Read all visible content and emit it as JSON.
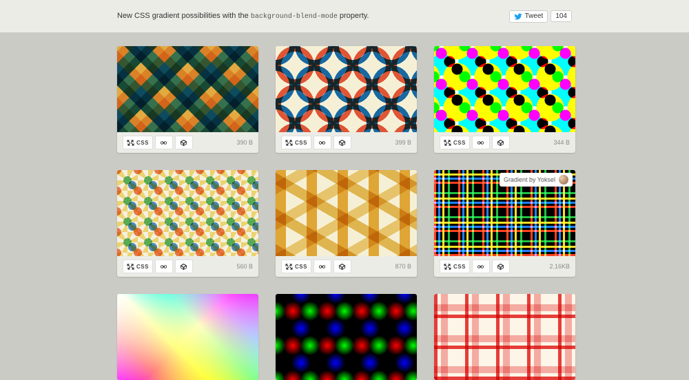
{
  "header": {
    "text_before": "New CSS gradient possibilities with the ",
    "code": "background-blend-mode",
    "text_after": " property.",
    "tweet_label": "Tweet",
    "tweet_count": "104"
  },
  "css_label": "CSS",
  "cards": [
    {
      "size": "390 B"
    },
    {
      "size": "399 B"
    },
    {
      "size": "344 B"
    },
    {
      "size": "560 B"
    },
    {
      "size": "870 B"
    },
    {
      "size": "2.16KB",
      "attribution": "Gradient by Yoksel"
    },
    {
      "size": ""
    },
    {
      "size": ""
    },
    {
      "size": ""
    }
  ]
}
